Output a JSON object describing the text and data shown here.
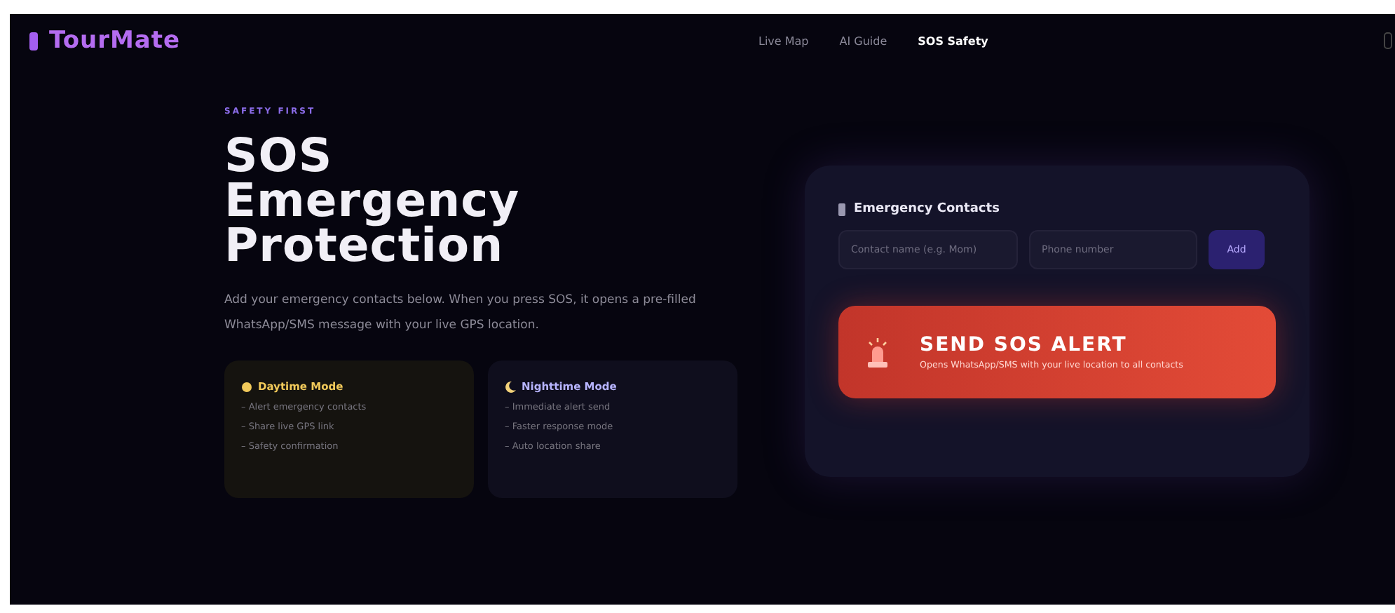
{
  "brand": "TourMate",
  "nav": [
    {
      "label": "Live Map",
      "selected": false
    },
    {
      "label": "AI Guide",
      "selected": false
    },
    {
      "label": "SOS Safety",
      "selected": true
    }
  ],
  "eyebrow": "SAFETY FIRST",
  "heading": [
    "SOS",
    "Emergency",
    "Protection"
  ],
  "intro": "Add your emergency contacts below. When you press SOS, it opens a pre-filled WhatsApp/SMS message with your live GPS location.",
  "modes": [
    {
      "kind": "day",
      "title": "Daytime Mode",
      "items": [
        "– Alert emergency contacts",
        "– Share live GPS link",
        "– Safety confirmation"
      ]
    },
    {
      "kind": "night",
      "title": "Nighttime Mode",
      "items": [
        "– Immediate alert send",
        "– Faster response mode",
        "– Auto location share"
      ]
    }
  ],
  "contacts": {
    "title": "Emergency Contacts",
    "name_placeholder": "Contact name (e.g. Mom)",
    "phone_placeholder": "Phone number",
    "add_button": "Add"
  },
  "sos": {
    "title": "SEND SOS ALERT",
    "subtitle": "Opens WhatsApp/SMS with your live location to all contacts"
  }
}
